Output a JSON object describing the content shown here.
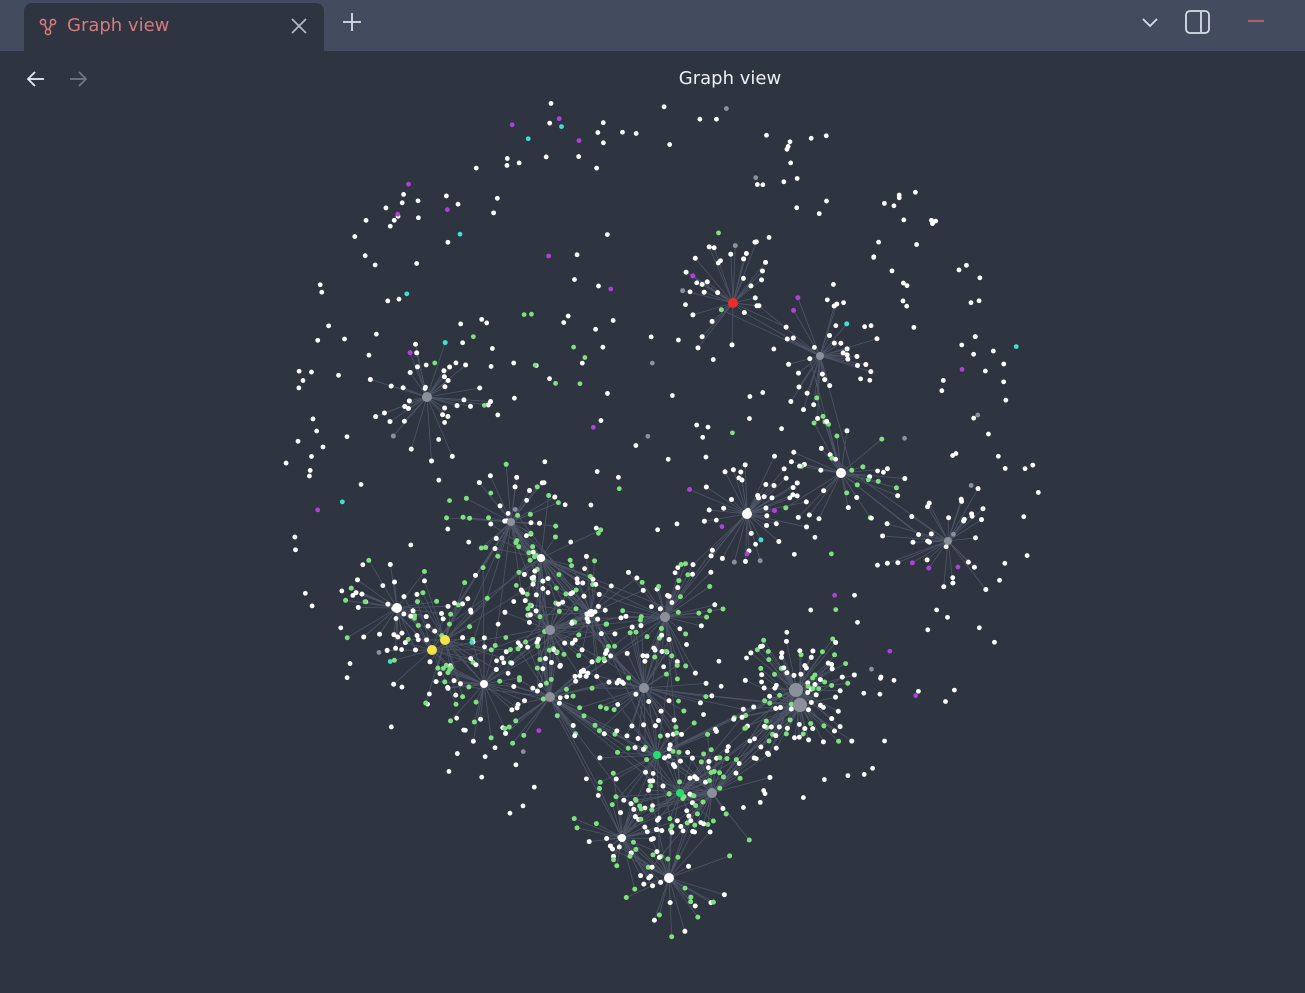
{
  "tab": {
    "title": "Graph view",
    "icon": "graph-icon",
    "accent": "#d57a7f"
  },
  "header": {
    "title": "Graph view",
    "back_icon": "arrow-left-icon",
    "forward_icon": "arrow-right-icon"
  },
  "toolbar": {
    "new_tab_icon": "plus-icon",
    "tab_list_icon": "chevron-down-icon",
    "sidebar_icon": "sidebar-toggle-icon",
    "minimize_icon": "minimize-icon"
  },
  "colors": {
    "background": "#2e3440",
    "tabbar": "#434c5e",
    "node_default": "#ffffff",
    "node_hub": "#8c909b",
    "node_green": "#7ee07e",
    "node_bright_green": "#22e06a",
    "node_cyan": "#3fe0d0",
    "node_purple": "#b13fdd",
    "node_red": "#ee2b2b",
    "node_yellow": "#f2e34a",
    "edge": "#4d5566"
  },
  "graph": {
    "node_count": 1000
  }
}
